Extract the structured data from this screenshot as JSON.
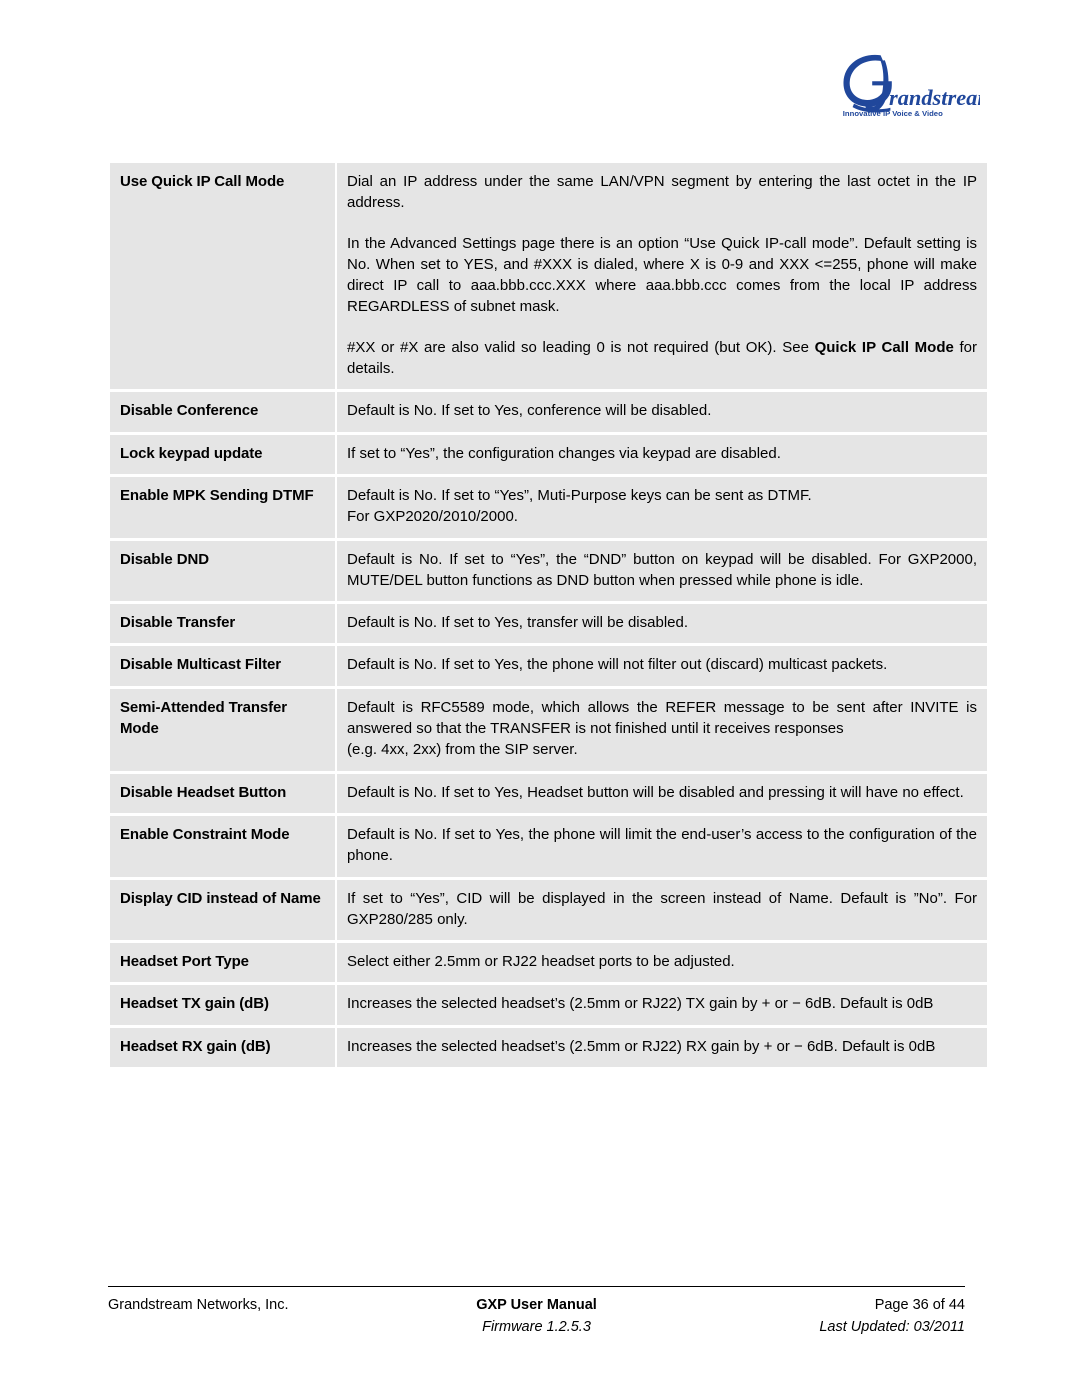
{
  "header": {
    "logo": {
      "name": "grandstream-logo",
      "wordmark": "randstream",
      "initial": "G",
      "tagline": "Innovative IP Voice & Video",
      "color": "#20479B"
    }
  },
  "table": {
    "rows": [
      {
        "label": "Use Quick IP Call Mode",
        "paragraphs": [
          {
            "text": "Dial an IP address under the same LAN/VPN segment by entering the last octet in the IP address.",
            "gap": false,
            "bold_tail": ""
          },
          {
            "text": "In the Advanced Settings page there is an option “Use Quick IP-call mode”. Default setting is No. When set to YES, and #XXX is dialed, where X is 0-9 and XXX <=255, phone will make direct IP call to aaa.bbb.ccc.XXX where aaa.bbb.ccc comes from the local IP address REGARDLESS of subnet mask.",
            "gap": true,
            "bold_tail": ""
          },
          {
            "text": "#XX or #X are also valid so leading 0 is not required (but OK).  See ",
            "gap": true,
            "bold_tail": "Quick IP Call Mode",
            "after_bold": " for details."
          }
        ]
      },
      {
        "label": "Disable Conference",
        "paragraphs": [
          {
            "text": "Default is No. If set to Yes, conference will be disabled.",
            "gap": false,
            "bold_tail": ""
          }
        ]
      },
      {
        "label": "Lock keypad update",
        "paragraphs": [
          {
            "text": "If set to “Yes”, the configuration changes via keypad are disabled.",
            "gap": false,
            "bold_tail": ""
          }
        ]
      },
      {
        "label": "Enable MPK Sending DTMF",
        "paragraphs": [
          {
            "text": "Default is No. If set to “Yes”, Muti-Purpose keys can be sent as DTMF.",
            "gap": false,
            "bold_tail": "",
            "nojust": true
          },
          {
            "text": "For GXP2020/2010/2000.",
            "gap": false,
            "bold_tail": "",
            "nojust": true
          }
        ]
      },
      {
        "label": "Disable DND",
        "paragraphs": [
          {
            "text": "Default is No. If set to “Yes”, the “DND” button on keypad will be disabled. For GXP2000, MUTE/DEL button functions as DND button when pressed while phone is idle.",
            "gap": false,
            "bold_tail": ""
          }
        ]
      },
      {
        "label": "Disable Transfer",
        "paragraphs": [
          {
            "text": "Default is No. If set to Yes, transfer will be disabled.",
            "gap": false,
            "bold_tail": ""
          }
        ]
      },
      {
        "label": "Disable Multicast Filter",
        "paragraphs": [
          {
            "text": "Default is No. If set to Yes, the phone will not filter out (discard) multicast packets.",
            "gap": false,
            "bold_tail": ""
          }
        ]
      },
      {
        "label": "Semi-Attended Transfer Mode",
        "paragraphs": [
          {
            "text": "Default is RFC5589 mode, which allows the REFER message to be sent after INVITE is answered so that the TRANSFER is not finished until it receives responses",
            "gap": false,
            "bold_tail": ""
          },
          {
            "text": "(e.g. 4xx, 2xx) from the SIP server.",
            "gap": false,
            "bold_tail": "",
            "nojust": true
          }
        ]
      },
      {
        "label": "Disable Headset Button",
        "paragraphs": [
          {
            "text": "Default is No. If set to Yes, Headset button will be disabled and pressing it will have no effect.",
            "gap": false,
            "bold_tail": ""
          }
        ]
      },
      {
        "label": "Enable Constraint Mode",
        "paragraphs": [
          {
            "text": "Default is No. If set to Yes, the phone will limit the end-user’s access to the configuration of the phone.",
            "gap": false,
            "bold_tail": ""
          }
        ]
      },
      {
        "label": "Display CID instead of Name",
        "paragraphs": [
          {
            "text": "If set to “Yes”, CID will be displayed in the screen instead of Name. Default is ”No”. For GXP280/285 only.",
            "gap": false,
            "bold_tail": ""
          }
        ]
      },
      {
        "label": "Headset Port Type",
        "paragraphs": [
          {
            "text": "Select either 2.5mm or RJ22 headset ports to be adjusted.",
            "gap": false,
            "bold_tail": ""
          }
        ]
      },
      {
        "label": "Headset TX gain (dB)",
        "paragraphs": [
          {
            "text": "Increases the selected headset’s (2.5mm or RJ22) TX gain by + or − 6dB. Default is 0dB",
            "gap": false,
            "bold_tail": ""
          }
        ]
      },
      {
        "label": "Headset RX gain (dB)",
        "paragraphs": [
          {
            "text": "Increases the selected headset’s (2.5mm or RJ22) RX gain by + or − 6dB. Default is 0dB",
            "gap": false,
            "bold_tail": ""
          }
        ]
      }
    ]
  },
  "footer": {
    "company": "Grandstream Networks, Inc.",
    "doc_title": "GXP User Manual",
    "firmware": "Firmware 1.2.5.3",
    "page": "Page 36 of 44",
    "updated": "Last Updated: 03/2011"
  }
}
